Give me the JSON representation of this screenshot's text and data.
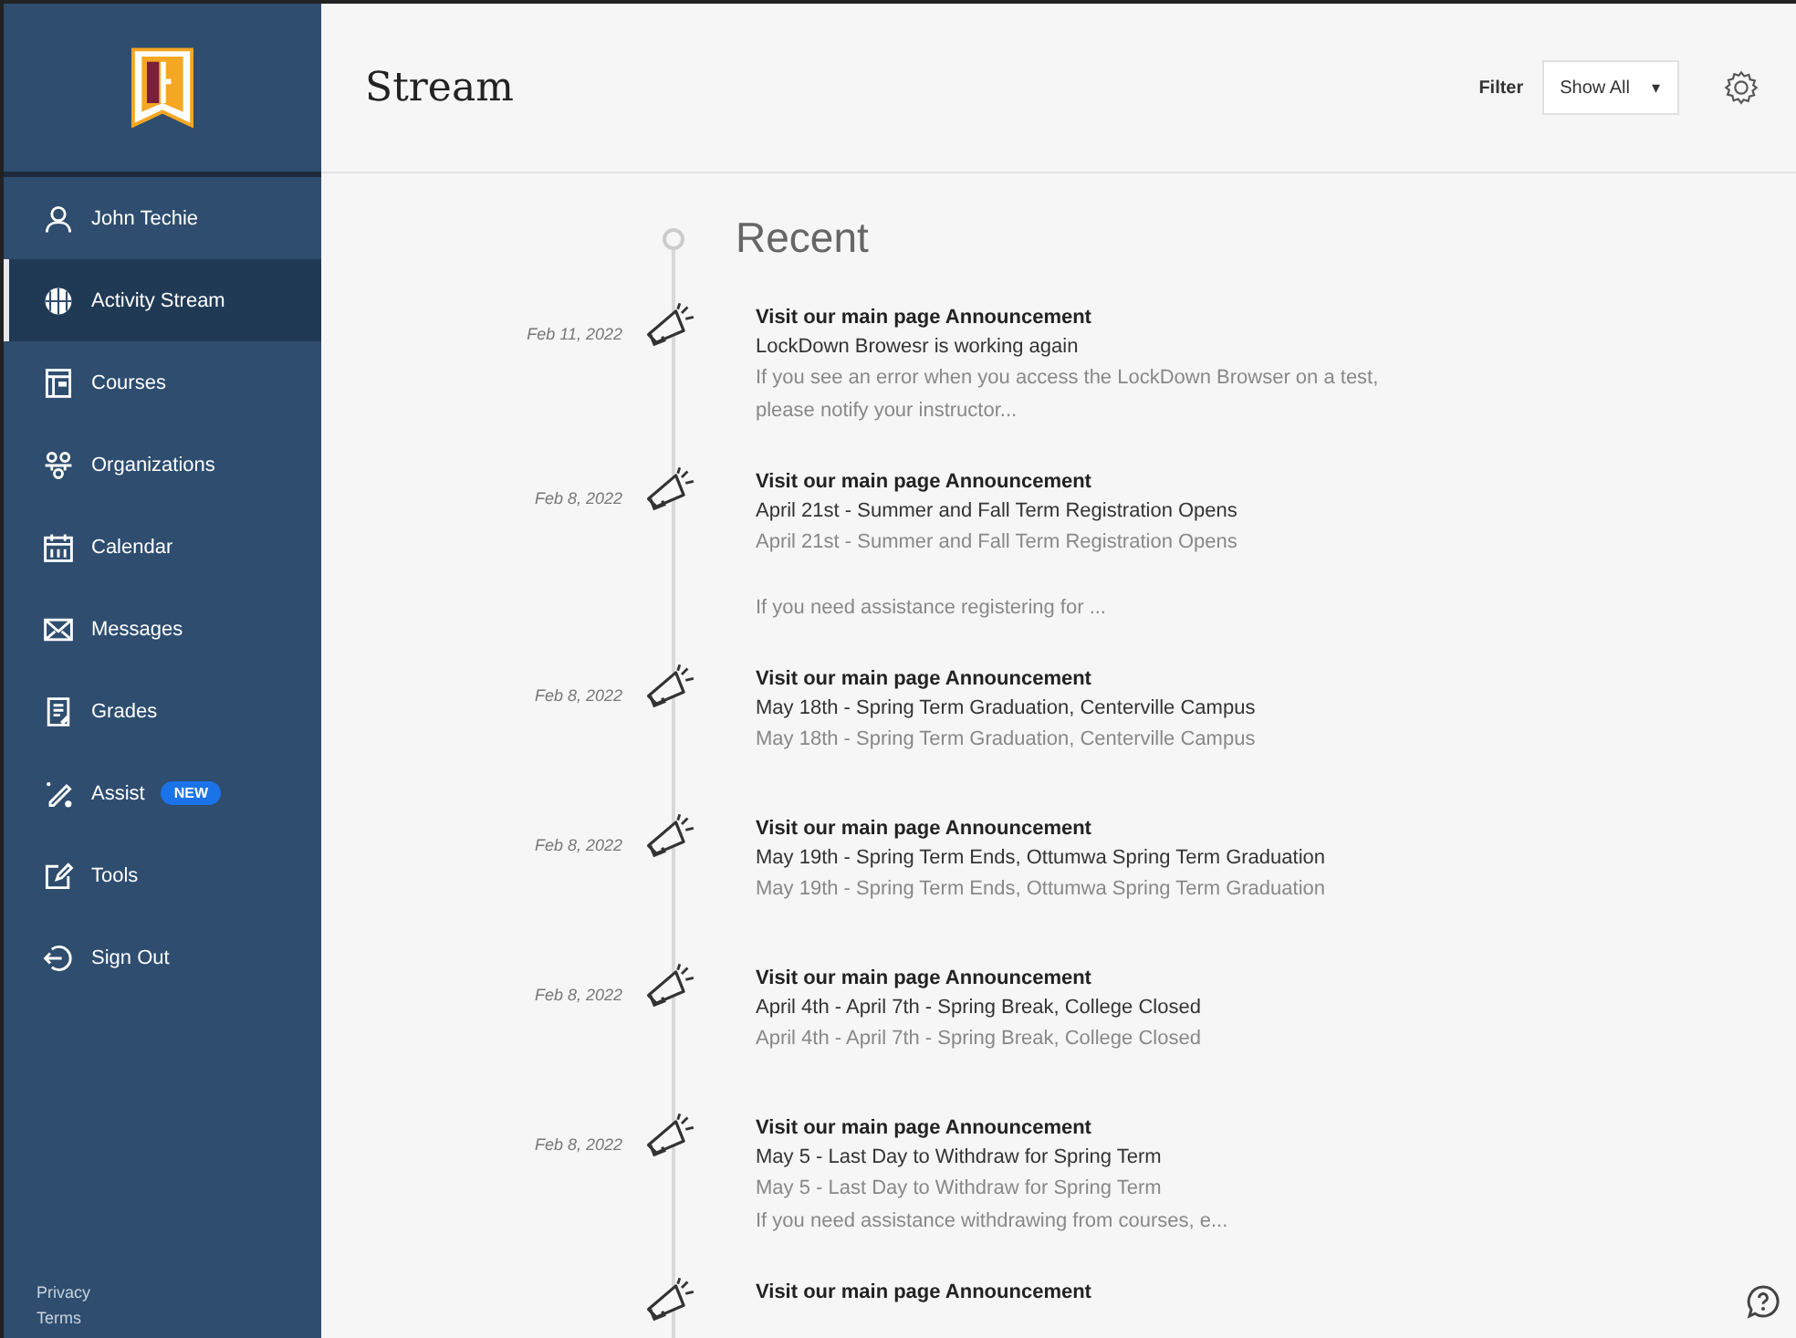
{
  "sidebar": {
    "items": [
      {
        "label": "John Techie",
        "selected": false
      },
      {
        "label": "Activity Stream",
        "selected": true
      },
      {
        "label": "Courses",
        "selected": false
      },
      {
        "label": "Organizations",
        "selected": false
      },
      {
        "label": "Calendar",
        "selected": false
      },
      {
        "label": "Messages",
        "selected": false
      },
      {
        "label": "Grades",
        "selected": false
      },
      {
        "label": "Assist",
        "selected": false,
        "badge": "NEW"
      },
      {
        "label": "Tools",
        "selected": false
      },
      {
        "label": "Sign Out",
        "selected": false
      }
    ],
    "footer_links": [
      "Privacy",
      "Terms"
    ]
  },
  "header": {
    "title": "Stream",
    "filter_label": "Filter",
    "filter_value": "Show All",
    "filter_caret": "▾"
  },
  "stream": {
    "heading": "Recent",
    "items": [
      {
        "date": "Feb 11, 2022",
        "lines": [
          {
            "kind": "title",
            "text": "Visit our main page Announcement"
          },
          {
            "kind": "subtitle",
            "text": "LockDown Browesr is working again"
          },
          {
            "kind": "body",
            "text": "If you see an error when you access the LockDown Browser on a test,"
          },
          {
            "kind": "body",
            "text": "please notify your instructor..."
          }
        ]
      },
      {
        "date": "Feb 8, 2022",
        "lines": [
          {
            "kind": "title",
            "text": "Visit our main page Announcement"
          },
          {
            "kind": "subtitle",
            "text": "April 21st - Summer and Fall Term Registration Opens"
          },
          {
            "kind": "body",
            "text": "April 21st - Summer and Fall Term Registration Opens"
          },
          {
            "kind": "note",
            "text": "If you need assistance registering for ..."
          }
        ]
      },
      {
        "date": "Feb 8, 2022",
        "lines": [
          {
            "kind": "title",
            "text": "Visit our main page Announcement"
          },
          {
            "kind": "subtitle",
            "text": "May 18th - Spring Term Graduation, Centerville Campus"
          },
          {
            "kind": "body",
            "text": "May 18th -  Spring Term Graduation, Centerville Campus"
          }
        ]
      },
      {
        "date": "Feb 8, 2022",
        "lines": [
          {
            "kind": "title",
            "text": "Visit our main page Announcement"
          },
          {
            "kind": "subtitle",
            "text": "May 19th - Spring Term Ends, Ottumwa Spring Term Graduation"
          },
          {
            "kind": "body",
            "text": "May 19th - Spring Term Ends, Ottumwa Spring Term Graduation"
          }
        ]
      },
      {
        "date": "Feb 8, 2022",
        "lines": [
          {
            "kind": "title",
            "text": "Visit our main page Announcement"
          },
          {
            "kind": "subtitle",
            "text": "April 4th - April 7th - Spring Break, College Closed"
          },
          {
            "kind": "body",
            "text": "April 4th - April 7th - Spring Break, College Closed"
          }
        ]
      },
      {
        "date": "Feb 8, 2022",
        "lines": [
          {
            "kind": "title",
            "text": "Visit our main page Announcement"
          },
          {
            "kind": "subtitle",
            "text": "May 5 - Last Day to Withdraw for Spring Term"
          },
          {
            "kind": "body",
            "text": "May 5 - Last Day to Withdraw for Spring Term"
          },
          {
            "kind": "body",
            "text": "If you need assistance withdrawing from courses, e..."
          }
        ]
      },
      {
        "lines": [
          {
            "kind": "title",
            "text": "Visit our main page Announcement"
          }
        ]
      }
    ]
  }
}
